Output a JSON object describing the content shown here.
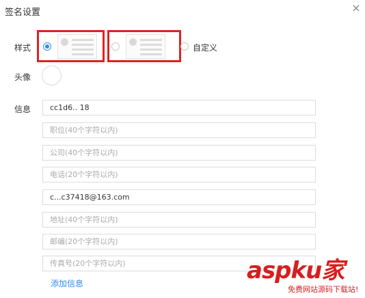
{
  "dialog": {
    "title": "签名设置",
    "close_symbol": "×"
  },
  "style_section": {
    "label": "样式",
    "options": [
      {
        "icon": "template-left-avatar-icon",
        "selected": true
      },
      {
        "icon": "template-left-avatar-icon",
        "selected": false
      }
    ],
    "custom_label": "自定义"
  },
  "avatar_section": {
    "label": "头像"
  },
  "info_section": {
    "label": "信息",
    "fields": [
      {
        "value": "cc1d6.. 18",
        "placeholder": ""
      },
      {
        "value": "",
        "placeholder": "职位(40个字符以内)"
      },
      {
        "value": "",
        "placeholder": "公司(40个字符以内)"
      },
      {
        "value": "",
        "placeholder": "电话(20个字符以内)"
      },
      {
        "value": "c...c37418@163.com",
        "placeholder": ""
      },
      {
        "value": "",
        "placeholder": "地址(40个字符以内)"
      },
      {
        "value": "",
        "placeholder": "邮编(20个字符以内)"
      },
      {
        "value": "",
        "placeholder": "传真号(20个字符以内)"
      }
    ],
    "add_link": "添加信息"
  },
  "colors": {
    "accent": "#2d8cf0",
    "highlight": "#e02020",
    "watermark": "#d81e1e"
  },
  "watermark": {
    "main": "aspku家",
    "sub": "免费网站源码下载站!"
  }
}
